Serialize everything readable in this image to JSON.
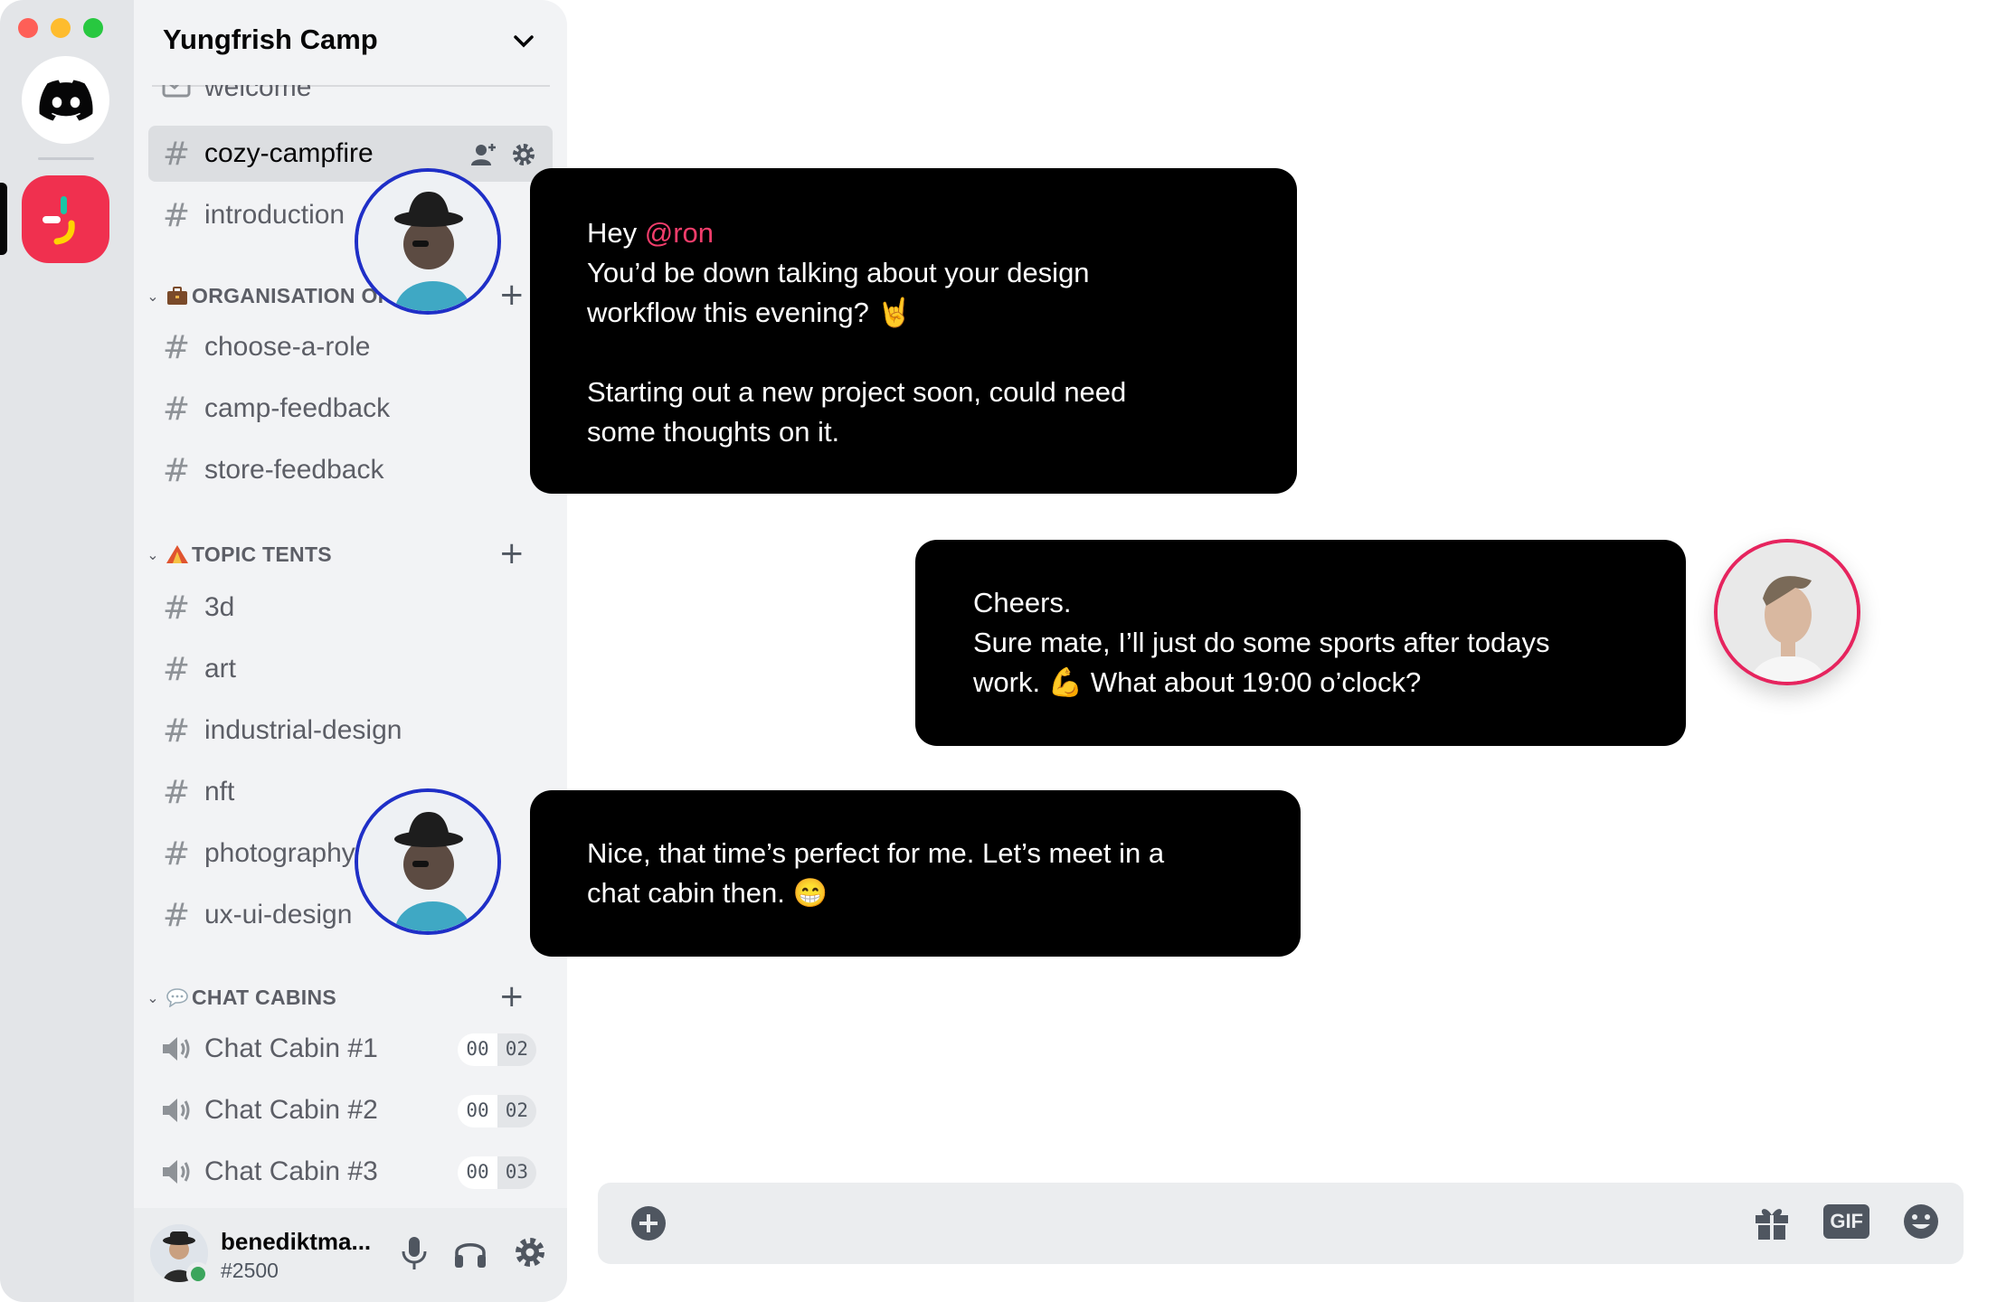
{
  "window": {
    "controls": [
      "close",
      "minimize",
      "maximize"
    ]
  },
  "rail": {
    "servers": [
      {
        "name": "Discord home",
        "icon": "discord-logo-icon"
      },
      {
        "name": "Yungfrish Camp",
        "icon": "camp-logo-icon",
        "color": "#f0304f",
        "selected": true
      }
    ]
  },
  "guild": {
    "name": "Yungfrish Camp"
  },
  "channels": {
    "top": [
      {
        "label": "welcome",
        "icon": "rules-icon"
      },
      {
        "label": "cozy-campfire",
        "icon": "hash-icon",
        "active": true
      },
      {
        "label": "introduction",
        "icon": "hash-icon"
      }
    ],
    "categories": [
      {
        "label": "ORGANISATION OF",
        "emoji": "briefcase-icon",
        "channels": [
          "choose-a-role",
          "camp-feedback",
          "store-feedback"
        ]
      },
      {
        "label": "TOPIC TENTS",
        "emoji": "tent-icon",
        "channels": [
          "3d",
          "art",
          "industrial-design",
          "nft",
          "photography",
          "ux-ui-design"
        ]
      },
      {
        "label": "CHAT CABINS",
        "emoji": "speech-bubble-icon",
        "voice": [
          {
            "label": "Chat Cabin #1",
            "count_a": "00",
            "count_b": "02"
          },
          {
            "label": "Chat Cabin #2",
            "count_a": "00",
            "count_b": "02"
          },
          {
            "label": "Chat Cabin #3",
            "count_a": "00",
            "count_b": "03"
          }
        ]
      }
    ]
  },
  "user": {
    "name": "benediktma...",
    "tag": "#2500",
    "status_color": "#3ba55c"
  },
  "messages": [
    {
      "side": "left",
      "lines": [
        "Hey ",
        "@ron",
        "You’d be down talking about your design",
        "workflow this evening? 🤘",
        "Starting out a new project soon, could need",
        "some thoughts on it."
      ]
    },
    {
      "side": "right",
      "lines": [
        "Cheers.",
        "Sure mate, I’ll just do some sports after todays",
        "work. 💪 What about 19:00 o’clock?"
      ]
    },
    {
      "side": "left",
      "lines": [
        "Nice, that time’s perfect for me. Let’s meet in a",
        "chat cabin then. 😁"
      ]
    }
  ],
  "composer": {
    "gif_label": "GIF"
  },
  "colors": {
    "mention": "#f23d6b",
    "bubble": "#000000",
    "avatar_ring_blue": "#1f2fc7",
    "avatar_ring_pink": "#e6245e"
  }
}
